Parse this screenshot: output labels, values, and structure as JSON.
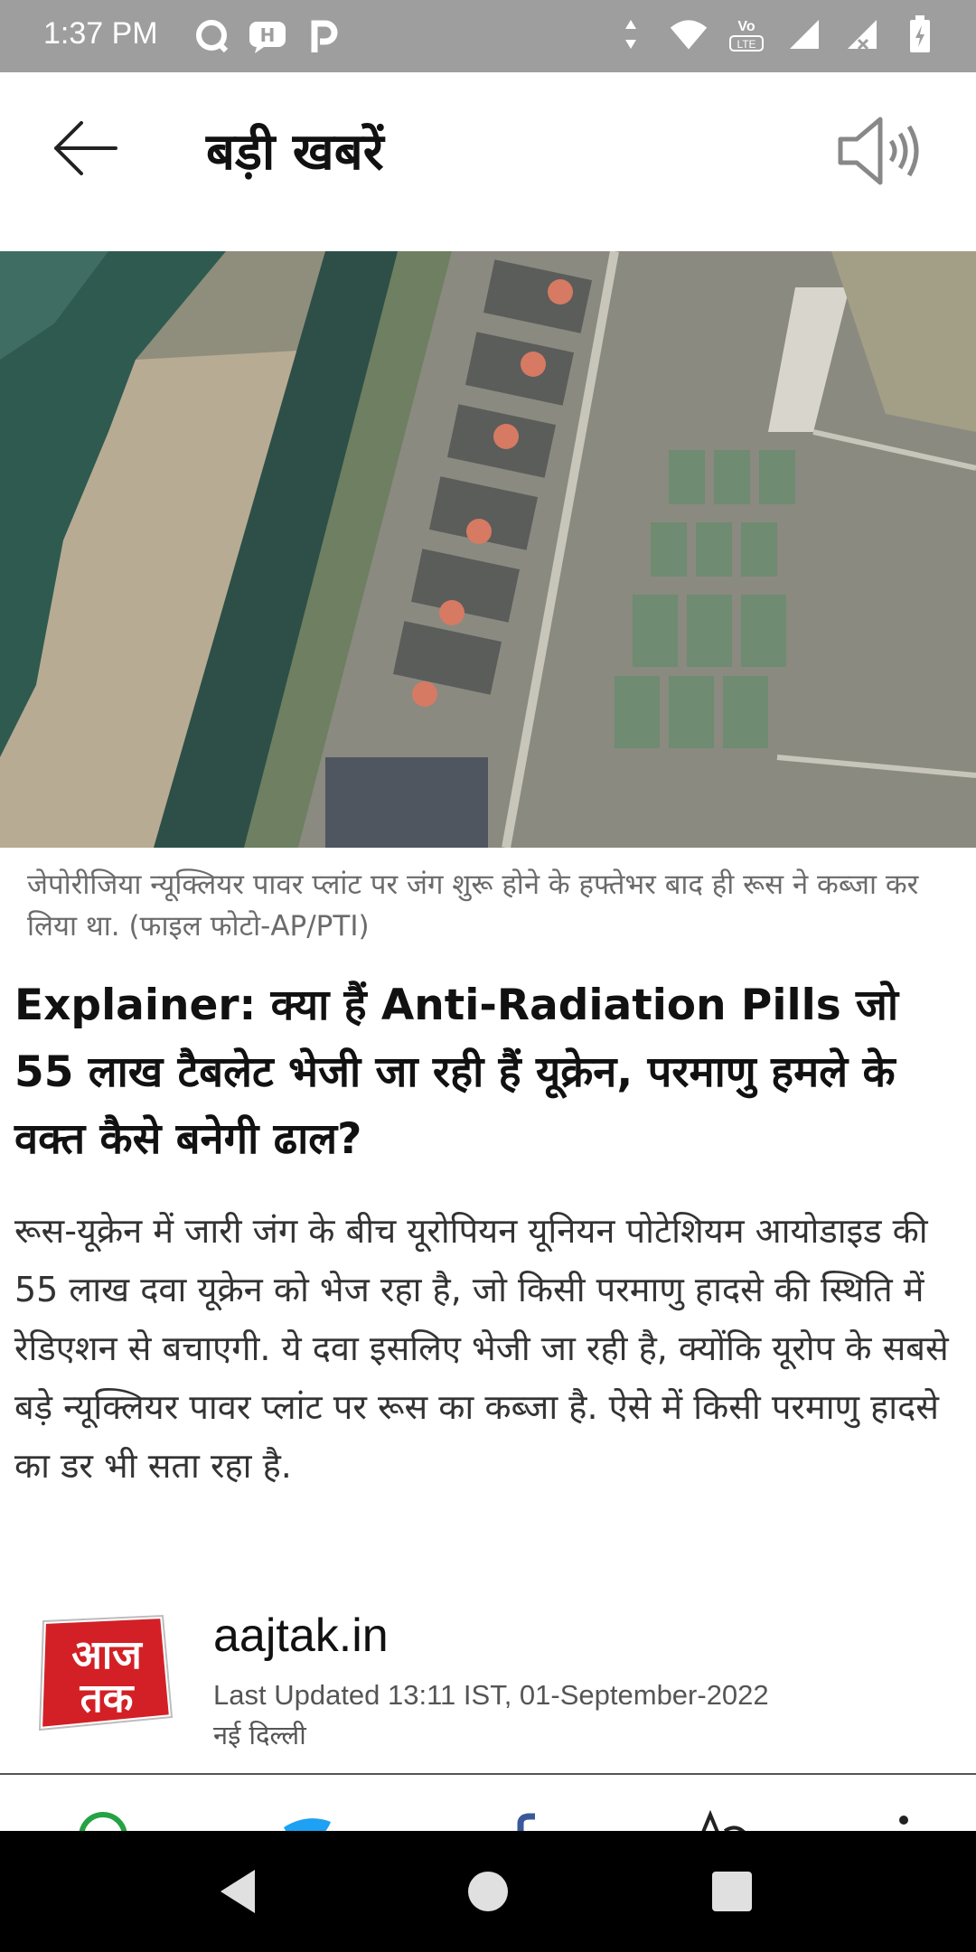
{
  "status_bar": {
    "time": "1:37 PM",
    "left_icons": [
      "chat-bubble-icon",
      "hike-icon",
      "p-app-icon"
    ],
    "right_icons": [
      "data-arrows-icon",
      "wifi-icon",
      "volte-icon",
      "signal-icon",
      "signal-x-icon",
      "battery-icon"
    ],
    "volte_label": "Vo LTE"
  },
  "header": {
    "title": "बड़ी खबरें",
    "back_icon": "arrow-left-icon",
    "speaker_icon": "speaker-icon"
  },
  "article": {
    "caption": "जेपोरीजिया न्यूक्लियर पावर प्लांट पर जंग शुरू होने के हफ्तेभर बाद ही रूस ने कब्जा कर लिया था. (फाइल फोटो-AP/PTI)",
    "headline": "Explainer: क्या हैं Anti-Radiation Pills जो 55 लाख टैबलेट भेजी जा रही हैं यूक्रेन, परमाणु हमले के वक्त कैसे बनेगी ढाल?",
    "summary": "रूस-यूक्रेन में जारी जंग के बीच यूरोपियन यूनियन पोटेशियम आयोडाइड की 55 लाख दवा यूक्रेन को भेज रहा है, जो किसी परमाणु हादसे की स्थिति में रेडिएशन से बचाएगी. ये दवा इसलिए भेजी जा रही है, क्योंकि यूरोप के सबसे बड़े न्यूक्लियर पावर प्लांट पर रूस का कब्जा है. ऐसे में किसी परमाणु हादसे का डर भी सता रहा है."
  },
  "source": {
    "logo_text_top": "आज",
    "logo_text_bottom": "तक",
    "name": "aajtak.in",
    "updated": "Last Updated 13:11 IST, 01-September-2022",
    "city": "नई दिल्ली"
  },
  "share_bar": {
    "icons": [
      "whatsapp-icon",
      "twitter-icon",
      "facebook-icon",
      "font-size-icon",
      "more-icon"
    ]
  },
  "nav_bar": {
    "icons": [
      "back-triangle-icon",
      "home-circle-icon",
      "recents-square-icon"
    ]
  },
  "colors": {
    "status_bar": "#9e9e9e",
    "logo_red": "#d32026",
    "nav_bar": "#000000"
  }
}
